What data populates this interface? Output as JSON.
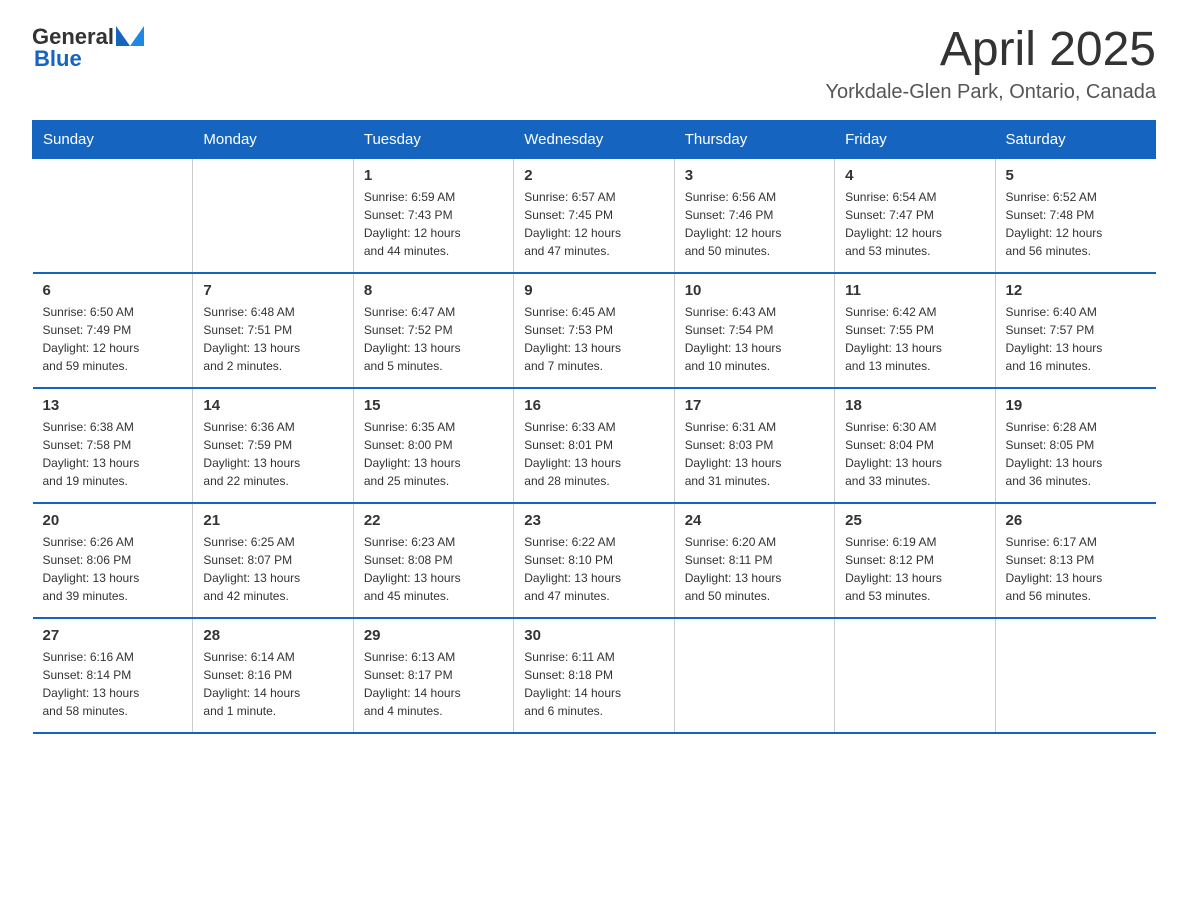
{
  "header": {
    "logo_general": "General",
    "logo_blue": "Blue",
    "month_year": "April 2025",
    "location": "Yorkdale-Glen Park, Ontario, Canada"
  },
  "days_of_week": [
    "Sunday",
    "Monday",
    "Tuesday",
    "Wednesday",
    "Thursday",
    "Friday",
    "Saturday"
  ],
  "weeks": [
    [
      {
        "day": "",
        "info": ""
      },
      {
        "day": "",
        "info": ""
      },
      {
        "day": "1",
        "info": "Sunrise: 6:59 AM\nSunset: 7:43 PM\nDaylight: 12 hours\nand 44 minutes."
      },
      {
        "day": "2",
        "info": "Sunrise: 6:57 AM\nSunset: 7:45 PM\nDaylight: 12 hours\nand 47 minutes."
      },
      {
        "day": "3",
        "info": "Sunrise: 6:56 AM\nSunset: 7:46 PM\nDaylight: 12 hours\nand 50 minutes."
      },
      {
        "day": "4",
        "info": "Sunrise: 6:54 AM\nSunset: 7:47 PM\nDaylight: 12 hours\nand 53 minutes."
      },
      {
        "day": "5",
        "info": "Sunrise: 6:52 AM\nSunset: 7:48 PM\nDaylight: 12 hours\nand 56 minutes."
      }
    ],
    [
      {
        "day": "6",
        "info": "Sunrise: 6:50 AM\nSunset: 7:49 PM\nDaylight: 12 hours\nand 59 minutes."
      },
      {
        "day": "7",
        "info": "Sunrise: 6:48 AM\nSunset: 7:51 PM\nDaylight: 13 hours\nand 2 minutes."
      },
      {
        "day": "8",
        "info": "Sunrise: 6:47 AM\nSunset: 7:52 PM\nDaylight: 13 hours\nand 5 minutes."
      },
      {
        "day": "9",
        "info": "Sunrise: 6:45 AM\nSunset: 7:53 PM\nDaylight: 13 hours\nand 7 minutes."
      },
      {
        "day": "10",
        "info": "Sunrise: 6:43 AM\nSunset: 7:54 PM\nDaylight: 13 hours\nand 10 minutes."
      },
      {
        "day": "11",
        "info": "Sunrise: 6:42 AM\nSunset: 7:55 PM\nDaylight: 13 hours\nand 13 minutes."
      },
      {
        "day": "12",
        "info": "Sunrise: 6:40 AM\nSunset: 7:57 PM\nDaylight: 13 hours\nand 16 minutes."
      }
    ],
    [
      {
        "day": "13",
        "info": "Sunrise: 6:38 AM\nSunset: 7:58 PM\nDaylight: 13 hours\nand 19 minutes."
      },
      {
        "day": "14",
        "info": "Sunrise: 6:36 AM\nSunset: 7:59 PM\nDaylight: 13 hours\nand 22 minutes."
      },
      {
        "day": "15",
        "info": "Sunrise: 6:35 AM\nSunset: 8:00 PM\nDaylight: 13 hours\nand 25 minutes."
      },
      {
        "day": "16",
        "info": "Sunrise: 6:33 AM\nSunset: 8:01 PM\nDaylight: 13 hours\nand 28 minutes."
      },
      {
        "day": "17",
        "info": "Sunrise: 6:31 AM\nSunset: 8:03 PM\nDaylight: 13 hours\nand 31 minutes."
      },
      {
        "day": "18",
        "info": "Sunrise: 6:30 AM\nSunset: 8:04 PM\nDaylight: 13 hours\nand 33 minutes."
      },
      {
        "day": "19",
        "info": "Sunrise: 6:28 AM\nSunset: 8:05 PM\nDaylight: 13 hours\nand 36 minutes."
      }
    ],
    [
      {
        "day": "20",
        "info": "Sunrise: 6:26 AM\nSunset: 8:06 PM\nDaylight: 13 hours\nand 39 minutes."
      },
      {
        "day": "21",
        "info": "Sunrise: 6:25 AM\nSunset: 8:07 PM\nDaylight: 13 hours\nand 42 minutes."
      },
      {
        "day": "22",
        "info": "Sunrise: 6:23 AM\nSunset: 8:08 PM\nDaylight: 13 hours\nand 45 minutes."
      },
      {
        "day": "23",
        "info": "Sunrise: 6:22 AM\nSunset: 8:10 PM\nDaylight: 13 hours\nand 47 minutes."
      },
      {
        "day": "24",
        "info": "Sunrise: 6:20 AM\nSunset: 8:11 PM\nDaylight: 13 hours\nand 50 minutes."
      },
      {
        "day": "25",
        "info": "Sunrise: 6:19 AM\nSunset: 8:12 PM\nDaylight: 13 hours\nand 53 minutes."
      },
      {
        "day": "26",
        "info": "Sunrise: 6:17 AM\nSunset: 8:13 PM\nDaylight: 13 hours\nand 56 minutes."
      }
    ],
    [
      {
        "day": "27",
        "info": "Sunrise: 6:16 AM\nSunset: 8:14 PM\nDaylight: 13 hours\nand 58 minutes."
      },
      {
        "day": "28",
        "info": "Sunrise: 6:14 AM\nSunset: 8:16 PM\nDaylight: 14 hours\nand 1 minute."
      },
      {
        "day": "29",
        "info": "Sunrise: 6:13 AM\nSunset: 8:17 PM\nDaylight: 14 hours\nand 4 minutes."
      },
      {
        "day": "30",
        "info": "Sunrise: 6:11 AM\nSunset: 8:18 PM\nDaylight: 14 hours\nand 6 minutes."
      },
      {
        "day": "",
        "info": ""
      },
      {
        "day": "",
        "info": ""
      },
      {
        "day": "",
        "info": ""
      }
    ]
  ]
}
